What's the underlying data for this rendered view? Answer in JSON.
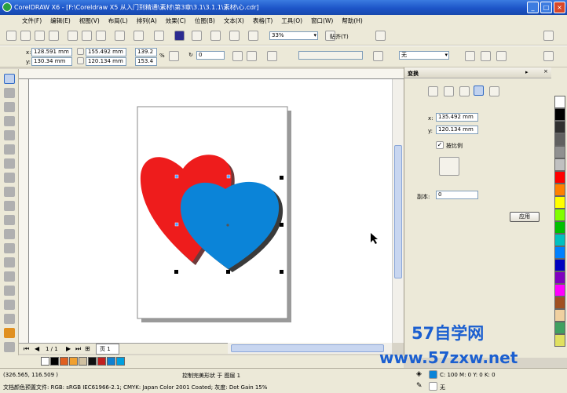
{
  "window": {
    "title": "CorelDRAW X6 - [F:\\Coreldraw X5  从入门到精通\\素材\\第3章\\3.1\\3.1.1\\素材\\心.cdr]",
    "min": "_",
    "max": "□",
    "close": "×"
  },
  "menu": [
    "文件(F)",
    "编辑(E)",
    "视图(V)",
    "布局(L)",
    "排列(A)",
    "效果(C)",
    "位图(B)",
    "文本(X)",
    "表格(T)",
    "工具(O)",
    "窗口(W)",
    "帮助(H)"
  ],
  "toolbar": {
    "zoom": "33%",
    "snap": "贴齐(T)"
  },
  "propbar": {
    "x": "128.591 mm",
    "y": "130.34 mm",
    "w": "155.492 mm",
    "h": "120.134 mm",
    "scale_w": "139.2",
    "scale_h": "153.4",
    "pct": "%",
    "rotation": "0",
    "outline": "无"
  },
  "pagetab": {
    "nav": "1 / 1",
    "page": "页 1"
  },
  "docker": {
    "title": "变换",
    "x_label": "x:",
    "x_value": "135.492 mm",
    "y_label": "y:",
    "y_value": "120.134 mm",
    "proportional": "按比例",
    "copies_label": "副本:",
    "copies_value": "0",
    "apply": "应用"
  },
  "status": {
    "coords": "(326.565, 116.509 )",
    "object": "控制完美形状 于 图层 1",
    "profile": "文档颜色预置文件: RGB: sRGB IEC61966-2.1; CMYK: Japan Color 2001 Coated; 灰度: Dot Gain 15%",
    "fill_info": "C: 100 M: 0 Y: 0 K: 0",
    "outline_info": "无"
  },
  "watermark": {
    "line1": "57自学网",
    "line2": "www.57zxw.net"
  },
  "colors": {
    "red_heart": "#ee1c1c",
    "blue_heart": "#0b84d8",
    "shadow": "#6e3a3a",
    "accent": "#316ac5"
  },
  "palette_bottom": [
    "#ffffff",
    "#000000",
    "#e06020",
    "#f0a030",
    "#d0c0a0",
    "#101010",
    "#c02020",
    "#1080d0",
    "#00a0e0"
  ],
  "palette_side": [
    "#ffffff",
    "#000000",
    "#303030",
    "#606060",
    "#909090",
    "#c0c0c0",
    "#ff0000",
    "#ff8000",
    "#ffff00",
    "#80ff00",
    "#00c000",
    "#00c0c0",
    "#0080ff",
    "#0000c0",
    "#8000c0",
    "#ff00ff",
    "#a05020",
    "#f0d0a0",
    "#40a060",
    "#e0e060"
  ]
}
